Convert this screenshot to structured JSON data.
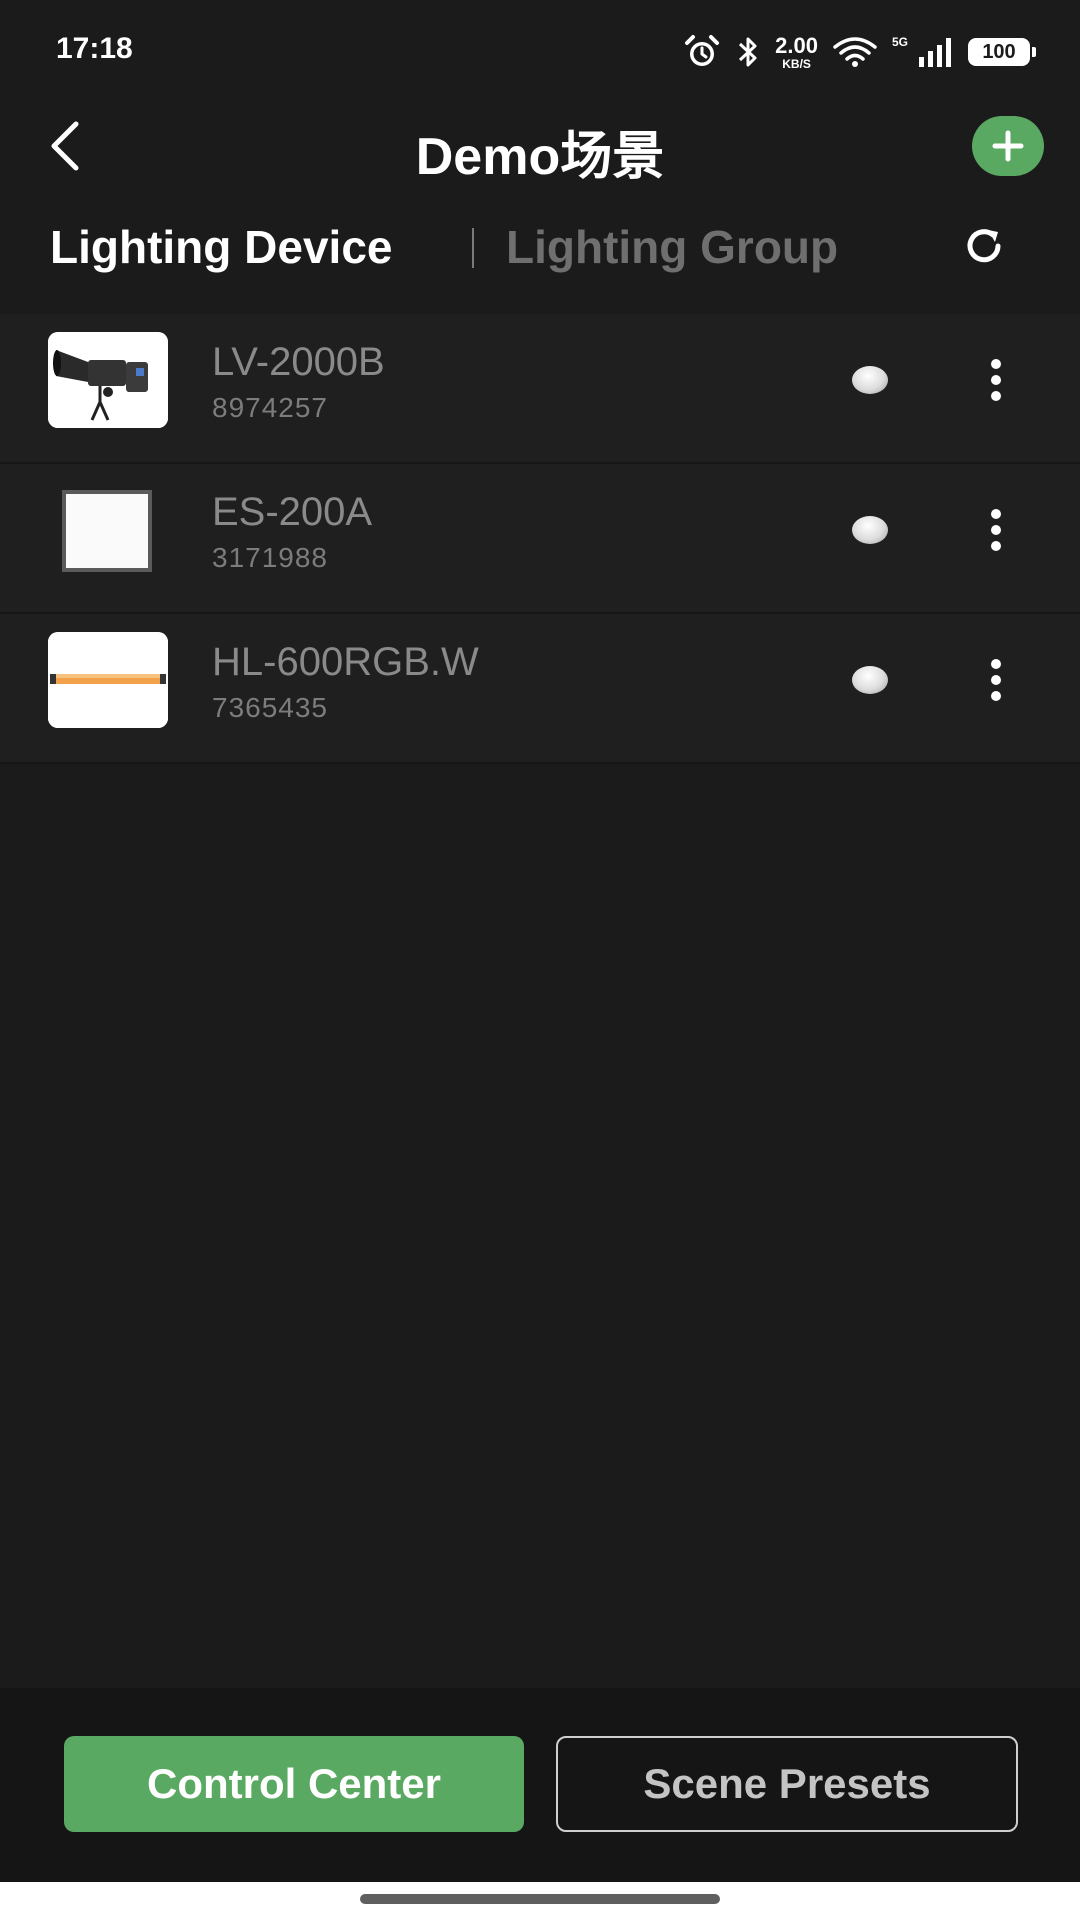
{
  "status_bar": {
    "time": "17:18",
    "net_speed_value": "2.00",
    "net_speed_unit": "KB/S",
    "network_type": "5G",
    "battery": "100",
    "icons": [
      "alarm-icon",
      "bluetooth-icon",
      "wifi-icon",
      "signal-icon",
      "battery-icon"
    ]
  },
  "header": {
    "title": "Demo场景",
    "back_icon": "back-arrow-icon",
    "add_icon": "plus-icon"
  },
  "tabs": {
    "items": [
      {
        "label": "Lighting Device",
        "active": true
      },
      {
        "label": "Lighting Group",
        "active": false
      }
    ],
    "refresh_icon": "refresh-icon"
  },
  "devices": [
    {
      "name": "LV-2000B",
      "id": "8974257",
      "thumbnail": "spotlight-image"
    },
    {
      "name": "ES-200A",
      "id": "3171988",
      "thumbnail": "light-panel-image"
    },
    {
      "name": "HL-600RGB.W",
      "id": "7365435",
      "thumbnail": "tube-light-image"
    }
  ],
  "bottom_bar": {
    "control_center_label": "Control Center",
    "scene_presets_label": "Scene Presets"
  },
  "colors": {
    "accent_green": "#5aa962",
    "background": "#1b1b1b",
    "row_background": "#1f1f1f"
  }
}
